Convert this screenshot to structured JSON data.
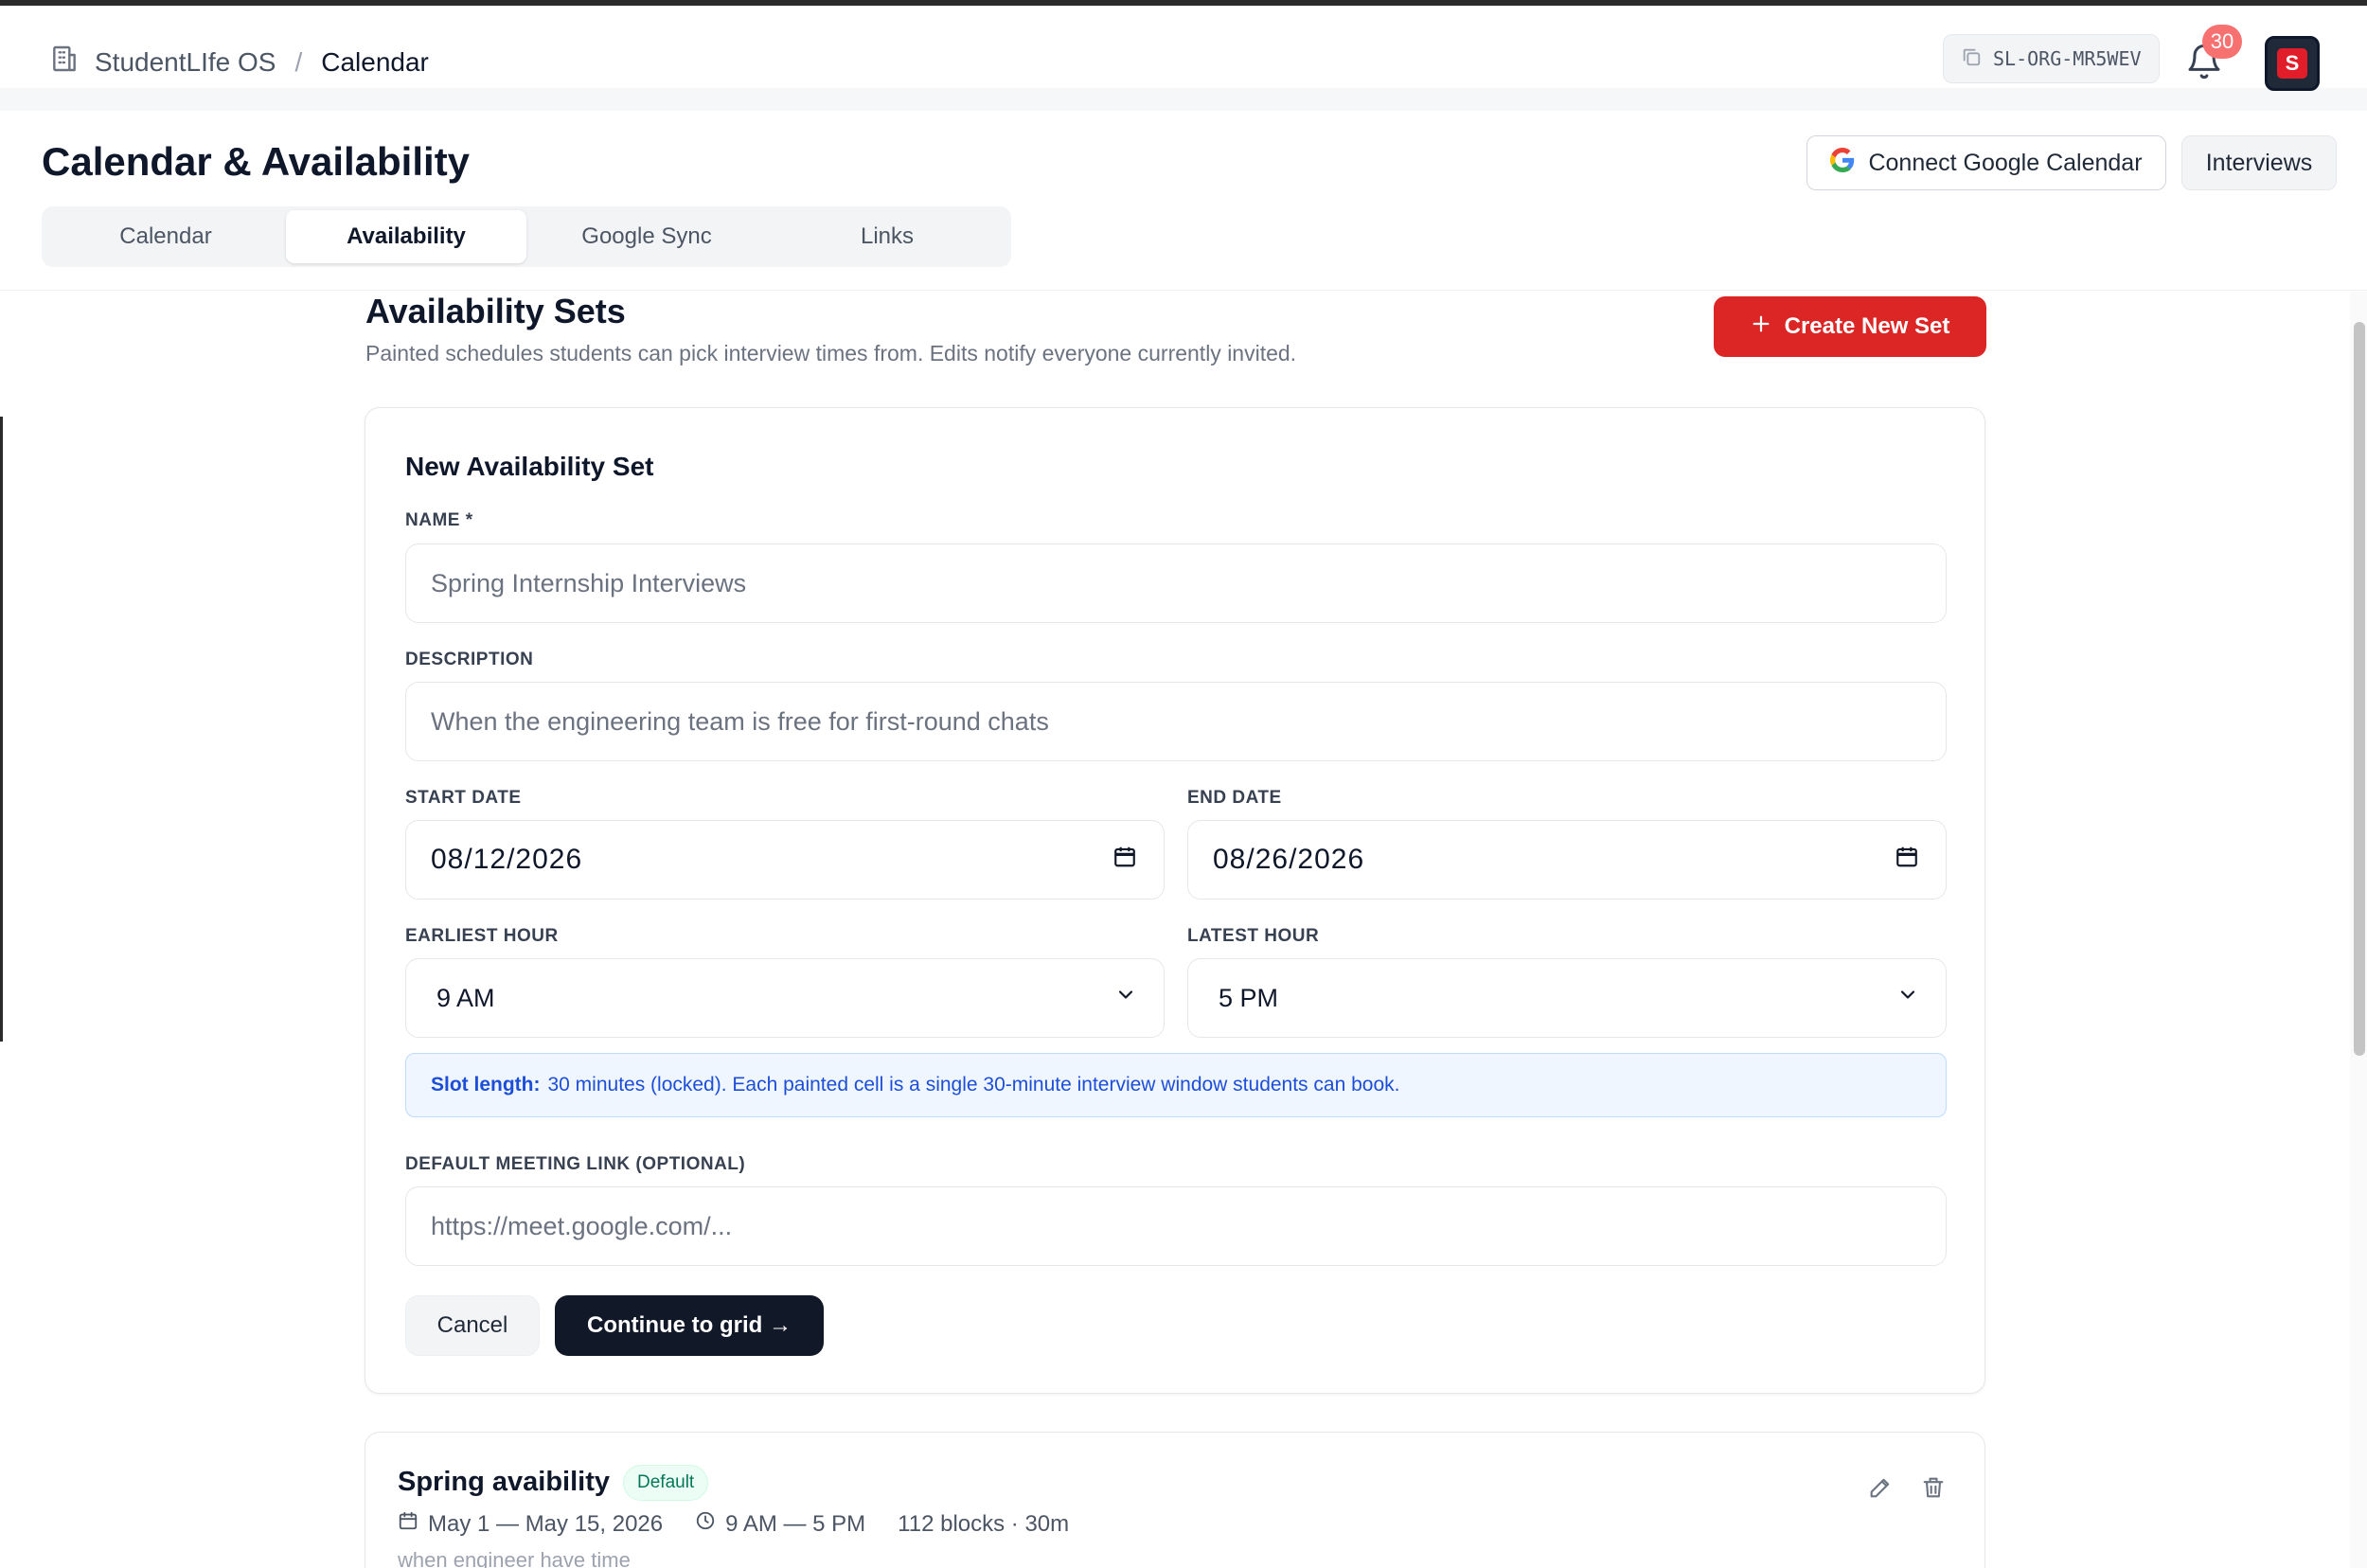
{
  "topbar": {
    "org_name": "StudentLIfe OS",
    "separator": "/",
    "current_page": "Calendar",
    "org_code": "SL-ORG-MR5WEV",
    "notification_count": "30"
  },
  "header": {
    "title": "Calendar & Availability",
    "connect_google_label": "Connect Google Calendar",
    "interviews_label": "Interviews",
    "tabs": [
      {
        "label": "Calendar",
        "active": false
      },
      {
        "label": "Availability",
        "active": true
      },
      {
        "label": "Google Sync",
        "active": false
      },
      {
        "label": "Links",
        "active": false
      }
    ]
  },
  "section": {
    "title": "Availability Sets",
    "subtitle": "Painted schedules students can pick interview times from. Edits notify everyone currently invited.",
    "create_label": "Create New Set"
  },
  "form": {
    "title": "New Availability Set",
    "name_label": "NAME *",
    "name_placeholder": "Spring Internship Interviews",
    "description_label": "DESCRIPTION",
    "description_placeholder": "When the engineering team is free for first-round chats",
    "start_date_label": "START DATE",
    "start_date_value": "08/12/2026",
    "end_date_label": "END DATE",
    "end_date_value": "08/26/2026",
    "earliest_hour_label": "EARLIEST HOUR",
    "earliest_hour_value": "9 AM",
    "latest_hour_label": "LATEST HOUR",
    "latest_hour_value": "5 PM",
    "slot_info_bold": "Slot length:",
    "slot_info_text": "30 minutes (locked). Each painted cell is a single 30-minute interview window students can book.",
    "meeting_link_label": "DEFAULT MEETING LINK (OPTIONAL)",
    "meeting_link_placeholder": "https://meet.google.com/...",
    "cancel_label": "Cancel",
    "continue_label": "Continue to grid →"
  },
  "sets": [
    {
      "name": "Spring avaibility",
      "badge": "Default",
      "date_range": "May 1 — May 15, 2026",
      "time_range": "9 AM — 5 PM",
      "blocks": "112 blocks · 30m",
      "description": "when engineer have time"
    }
  ],
  "colors": {
    "primary_red": "#dc2626",
    "dark_button": "#111827",
    "info_blue": "#1d4ed8",
    "badge_green": "#047857"
  }
}
